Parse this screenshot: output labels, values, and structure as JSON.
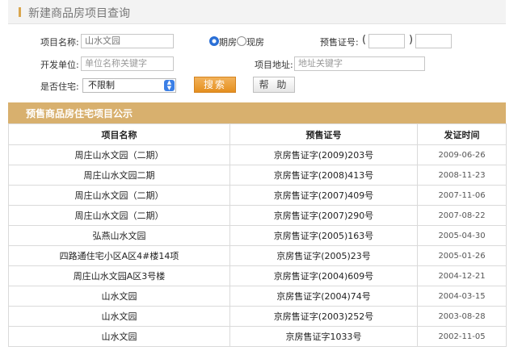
{
  "page": {
    "title": "新建商品房项目查询"
  },
  "form": {
    "project_name": {
      "label": "项目名称:",
      "value": "山水文园"
    },
    "sale_type": {
      "options": [
        "期房",
        "现房"
      ],
      "selected": "期房"
    },
    "presale_no": {
      "label": "预售证号:",
      "open_paren": "(",
      "close_paren": ")",
      "part1": "",
      "part2": ""
    },
    "developer": {
      "label": "开发单位:",
      "placeholder": "单位名称关键字"
    },
    "address": {
      "label": "项目地址:",
      "placeholder": "地址关键字"
    },
    "residential": {
      "label": "是否住宅:",
      "selected": "不限制"
    },
    "search_label": "搜索",
    "help_label": "帮 助"
  },
  "section": {
    "title": "预售商品房住宅项目公示"
  },
  "table": {
    "headers": [
      "项目名称",
      "预售证号",
      "发证时间"
    ],
    "rows": [
      [
        "周庄山水文园（二期）",
        "京房售证字(2009)203号",
        "2009-06-26"
      ],
      [
        "周庄山水文园二期",
        "京房售证字(2008)413号",
        "2008-11-23"
      ],
      [
        "周庄山水文园（二期）",
        "京房售证字(2007)409号",
        "2007-11-06"
      ],
      [
        "周庄山水文园（二期）",
        "京房售证字(2007)290号",
        "2007-08-22"
      ],
      [
        "弘燕山水文园",
        "京房售证字(2005)163号",
        "2005-04-30"
      ],
      [
        "四路通住宅小区A区4#楼14项",
        "京房售证字(2005)23号",
        "2005-01-26"
      ],
      [
        "周庄山水文园A区3号楼",
        "京房售证字(2004)609号",
        "2004-12-21"
      ],
      [
        "山水文园",
        "京房售证字(2004)74号",
        "2004-03-15"
      ],
      [
        "山水文园",
        "京房售证字(2003)252号",
        "2003-08-28"
      ],
      [
        "山水文园",
        "京房售证字1033号",
        "2002-11-05"
      ]
    ]
  }
}
